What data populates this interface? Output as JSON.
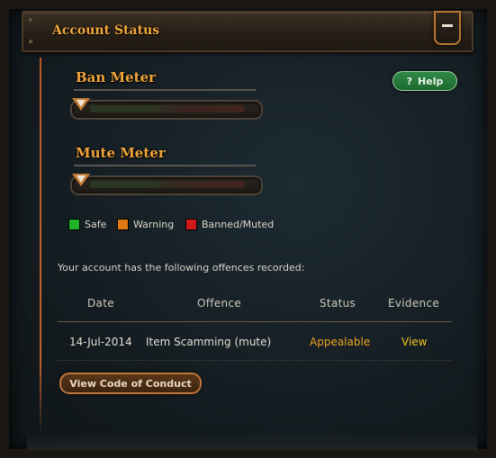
{
  "panel": {
    "title": "Account Status",
    "collapse_icon": "minus-icon"
  },
  "help": {
    "label": "Help",
    "icon": "question-icon",
    "icon_glyph": "?"
  },
  "ban_meter": {
    "label": "Ban Meter",
    "level": 0
  },
  "mute_meter": {
    "label": "Mute Meter",
    "level": 0
  },
  "legend": [
    {
      "label": "Safe",
      "color": "#1fb32a"
    },
    {
      "label": "Warning",
      "color": "#e07a12"
    },
    {
      "label": "Banned/Muted",
      "color": "#d01a1a"
    }
  ],
  "offences": {
    "intro": "Your account has the following offences recorded:",
    "columns": [
      "Date",
      "Offence",
      "Status",
      "Evidence"
    ],
    "rows": [
      {
        "date": "14-Jul-2014",
        "offence": "Item Scamming (mute)",
        "status": "Appealable",
        "evidence": "View"
      }
    ]
  },
  "code_of_conduct_button": "View Code of Conduct",
  "colors": {
    "title_orange": "#f0a43a",
    "status_orange": "#f0a020",
    "evidence_yellow": "#f2c51e",
    "help_green": "#2f8a46"
  }
}
